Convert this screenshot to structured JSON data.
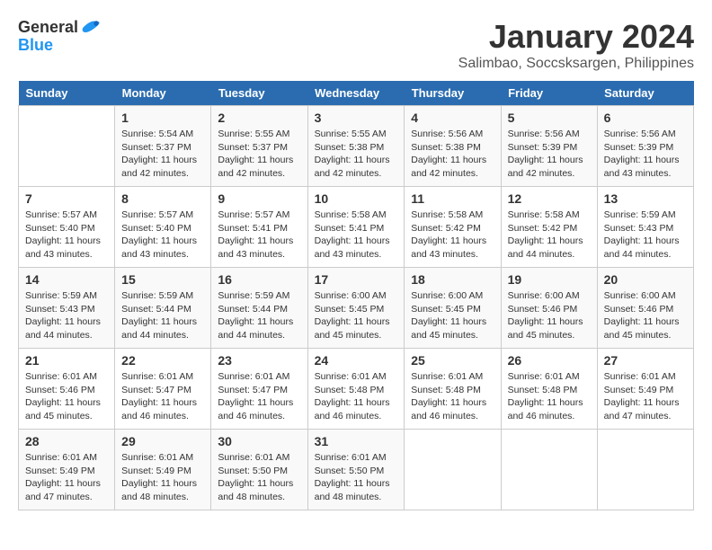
{
  "header": {
    "logo_general": "General",
    "logo_blue": "Blue",
    "month": "January 2024",
    "location": "Salimbao, Soccsksargen, Philippines"
  },
  "days_of_week": [
    "Sunday",
    "Monday",
    "Tuesday",
    "Wednesday",
    "Thursday",
    "Friday",
    "Saturday"
  ],
  "weeks": [
    [
      {
        "day": "",
        "sunrise": "",
        "sunset": "",
        "daylight": ""
      },
      {
        "day": "1",
        "sunrise": "Sunrise: 5:54 AM",
        "sunset": "Sunset: 5:37 PM",
        "daylight": "Daylight: 11 hours and 42 minutes."
      },
      {
        "day": "2",
        "sunrise": "Sunrise: 5:55 AM",
        "sunset": "Sunset: 5:37 PM",
        "daylight": "Daylight: 11 hours and 42 minutes."
      },
      {
        "day": "3",
        "sunrise": "Sunrise: 5:55 AM",
        "sunset": "Sunset: 5:38 PM",
        "daylight": "Daylight: 11 hours and 42 minutes."
      },
      {
        "day": "4",
        "sunrise": "Sunrise: 5:56 AM",
        "sunset": "Sunset: 5:38 PM",
        "daylight": "Daylight: 11 hours and 42 minutes."
      },
      {
        "day": "5",
        "sunrise": "Sunrise: 5:56 AM",
        "sunset": "Sunset: 5:39 PM",
        "daylight": "Daylight: 11 hours and 42 minutes."
      },
      {
        "day": "6",
        "sunrise": "Sunrise: 5:56 AM",
        "sunset": "Sunset: 5:39 PM",
        "daylight": "Daylight: 11 hours and 43 minutes."
      }
    ],
    [
      {
        "day": "7",
        "sunrise": "Sunrise: 5:57 AM",
        "sunset": "Sunset: 5:40 PM",
        "daylight": "Daylight: 11 hours and 43 minutes."
      },
      {
        "day": "8",
        "sunrise": "Sunrise: 5:57 AM",
        "sunset": "Sunset: 5:40 PM",
        "daylight": "Daylight: 11 hours and 43 minutes."
      },
      {
        "day": "9",
        "sunrise": "Sunrise: 5:57 AM",
        "sunset": "Sunset: 5:41 PM",
        "daylight": "Daylight: 11 hours and 43 minutes."
      },
      {
        "day": "10",
        "sunrise": "Sunrise: 5:58 AM",
        "sunset": "Sunset: 5:41 PM",
        "daylight": "Daylight: 11 hours and 43 minutes."
      },
      {
        "day": "11",
        "sunrise": "Sunrise: 5:58 AM",
        "sunset": "Sunset: 5:42 PM",
        "daylight": "Daylight: 11 hours and 43 minutes."
      },
      {
        "day": "12",
        "sunrise": "Sunrise: 5:58 AM",
        "sunset": "Sunset: 5:42 PM",
        "daylight": "Daylight: 11 hours and 44 minutes."
      },
      {
        "day": "13",
        "sunrise": "Sunrise: 5:59 AM",
        "sunset": "Sunset: 5:43 PM",
        "daylight": "Daylight: 11 hours and 44 minutes."
      }
    ],
    [
      {
        "day": "14",
        "sunrise": "Sunrise: 5:59 AM",
        "sunset": "Sunset: 5:43 PM",
        "daylight": "Daylight: 11 hours and 44 minutes."
      },
      {
        "day": "15",
        "sunrise": "Sunrise: 5:59 AM",
        "sunset": "Sunset: 5:44 PM",
        "daylight": "Daylight: 11 hours and 44 minutes."
      },
      {
        "day": "16",
        "sunrise": "Sunrise: 5:59 AM",
        "sunset": "Sunset: 5:44 PM",
        "daylight": "Daylight: 11 hours and 44 minutes."
      },
      {
        "day": "17",
        "sunrise": "Sunrise: 6:00 AM",
        "sunset": "Sunset: 5:45 PM",
        "daylight": "Daylight: 11 hours and 45 minutes."
      },
      {
        "day": "18",
        "sunrise": "Sunrise: 6:00 AM",
        "sunset": "Sunset: 5:45 PM",
        "daylight": "Daylight: 11 hours and 45 minutes."
      },
      {
        "day": "19",
        "sunrise": "Sunrise: 6:00 AM",
        "sunset": "Sunset: 5:46 PM",
        "daylight": "Daylight: 11 hours and 45 minutes."
      },
      {
        "day": "20",
        "sunrise": "Sunrise: 6:00 AM",
        "sunset": "Sunset: 5:46 PM",
        "daylight": "Daylight: 11 hours and 45 minutes."
      }
    ],
    [
      {
        "day": "21",
        "sunrise": "Sunrise: 6:01 AM",
        "sunset": "Sunset: 5:46 PM",
        "daylight": "Daylight: 11 hours and 45 minutes."
      },
      {
        "day": "22",
        "sunrise": "Sunrise: 6:01 AM",
        "sunset": "Sunset: 5:47 PM",
        "daylight": "Daylight: 11 hours and 46 minutes."
      },
      {
        "day": "23",
        "sunrise": "Sunrise: 6:01 AM",
        "sunset": "Sunset: 5:47 PM",
        "daylight": "Daylight: 11 hours and 46 minutes."
      },
      {
        "day": "24",
        "sunrise": "Sunrise: 6:01 AM",
        "sunset": "Sunset: 5:48 PM",
        "daylight": "Daylight: 11 hours and 46 minutes."
      },
      {
        "day": "25",
        "sunrise": "Sunrise: 6:01 AM",
        "sunset": "Sunset: 5:48 PM",
        "daylight": "Daylight: 11 hours and 46 minutes."
      },
      {
        "day": "26",
        "sunrise": "Sunrise: 6:01 AM",
        "sunset": "Sunset: 5:48 PM",
        "daylight": "Daylight: 11 hours and 46 minutes."
      },
      {
        "day": "27",
        "sunrise": "Sunrise: 6:01 AM",
        "sunset": "Sunset: 5:49 PM",
        "daylight": "Daylight: 11 hours and 47 minutes."
      }
    ],
    [
      {
        "day": "28",
        "sunrise": "Sunrise: 6:01 AM",
        "sunset": "Sunset: 5:49 PM",
        "daylight": "Daylight: 11 hours and 47 minutes."
      },
      {
        "day": "29",
        "sunrise": "Sunrise: 6:01 AM",
        "sunset": "Sunset: 5:49 PM",
        "daylight": "Daylight: 11 hours and 48 minutes."
      },
      {
        "day": "30",
        "sunrise": "Sunrise: 6:01 AM",
        "sunset": "Sunset: 5:50 PM",
        "daylight": "Daylight: 11 hours and 48 minutes."
      },
      {
        "day": "31",
        "sunrise": "Sunrise: 6:01 AM",
        "sunset": "Sunset: 5:50 PM",
        "daylight": "Daylight: 11 hours and 48 minutes."
      },
      {
        "day": "",
        "sunrise": "",
        "sunset": "",
        "daylight": ""
      },
      {
        "day": "",
        "sunrise": "",
        "sunset": "",
        "daylight": ""
      },
      {
        "day": "",
        "sunrise": "",
        "sunset": "",
        "daylight": ""
      }
    ]
  ]
}
